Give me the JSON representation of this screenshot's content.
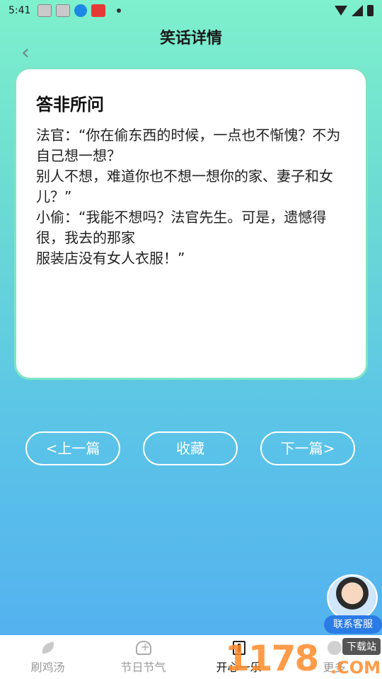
{
  "status": {
    "time": "5:41"
  },
  "header": {
    "title": "笑话详情",
    "back_icon": "‹"
  },
  "joke": {
    "title": "答非所问",
    "body": "法官：“你在偷东西的时候，一点也不惭愧？不为自己想一想？\n别人不想，难道你也不想一想你的家、妻子和女儿？”\n小偷：“我能不想吗？法官先生。可是，遗憾得很，我去的那家\n服装店没有女人衣服！”"
  },
  "actions": {
    "prev_label": "<上一篇",
    "favorite_label": "收藏",
    "next_label": "下一篇>"
  },
  "service": {
    "label": "联系客服"
  },
  "nav": {
    "items": [
      {
        "label": "刷鸡汤",
        "icon": "leaf-icon",
        "active": false
      },
      {
        "label": "节日节气",
        "icon": "heart-plus-icon",
        "active": false
      },
      {
        "label": "开心一乐",
        "icon": "book-icon",
        "active": true
      },
      {
        "label": "更多",
        "icon": "more-icon",
        "active": false
      }
    ]
  },
  "watermark": {
    "number": "1178",
    "tag": "下载站",
    "domain": ".COM"
  },
  "colors": {
    "gradient_top": "#7ef0cc",
    "gradient_bottom": "#52aef1",
    "card_border": "#7fe5c5",
    "service_blue": "#2b7be6"
  }
}
